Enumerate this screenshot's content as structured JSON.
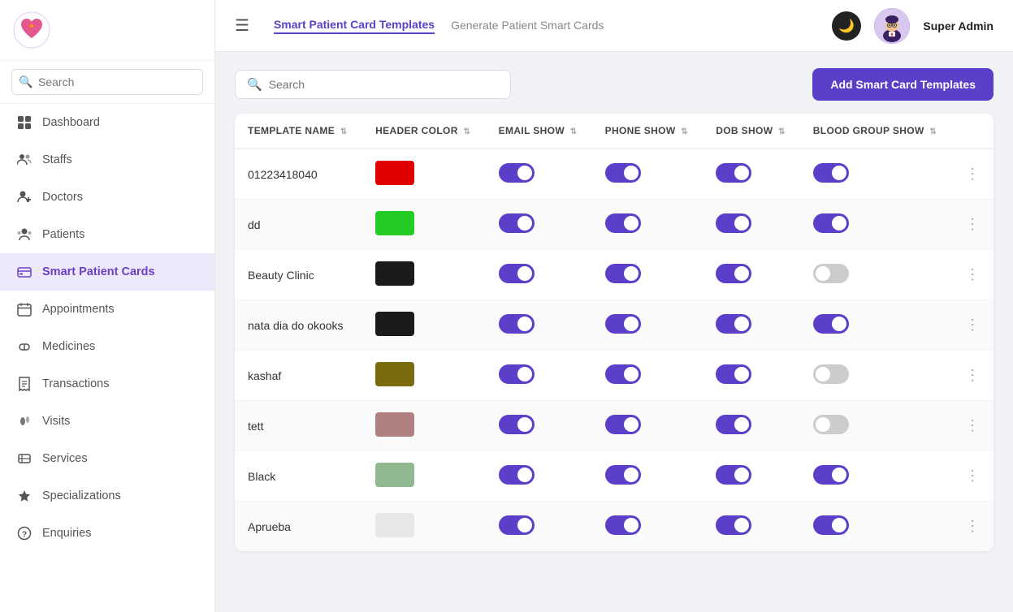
{
  "sidebar": {
    "logo_alt": "App Logo",
    "search_placeholder": "Search",
    "nav_items": [
      {
        "id": "dashboard",
        "label": "Dashboard",
        "icon": "grid",
        "active": false
      },
      {
        "id": "staffs",
        "label": "Staffs",
        "icon": "people",
        "active": false
      },
      {
        "id": "doctors",
        "label": "Doctors",
        "icon": "person-add",
        "active": false
      },
      {
        "id": "patients",
        "label": "Patients",
        "icon": "people-group",
        "active": false
      },
      {
        "id": "smart-patient-cards",
        "label": "Smart Patient Cards",
        "icon": "card",
        "active": true
      },
      {
        "id": "appointments",
        "label": "Appointments",
        "icon": "calendar",
        "active": false
      },
      {
        "id": "medicines",
        "label": "Medicines",
        "icon": "pill",
        "active": false
      },
      {
        "id": "transactions",
        "label": "Transactions",
        "icon": "receipt",
        "active": false
      },
      {
        "id": "visits",
        "label": "Visits",
        "icon": "footprint",
        "active": false
      },
      {
        "id": "services",
        "label": "Services",
        "icon": "service",
        "active": false
      },
      {
        "id": "specializations",
        "label": "Specializations",
        "icon": "star",
        "active": false
      },
      {
        "id": "enquiries",
        "label": "Enquiries",
        "icon": "question",
        "active": false
      }
    ]
  },
  "header": {
    "title": "Smart Patient Card Templates",
    "sub_link": "Generate Patient Smart Cards",
    "user_name": "Super Admin",
    "dark_mode_icon": "🌙"
  },
  "toolbar": {
    "search_placeholder": "Search",
    "add_button_label": "Add Smart Card Templates"
  },
  "table": {
    "columns": [
      {
        "id": "template_name",
        "label": "TEMPLATE NAME"
      },
      {
        "id": "header_color",
        "label": "HEADER COLOR"
      },
      {
        "id": "email_show",
        "label": "EMAIL SHOW"
      },
      {
        "id": "phone_show",
        "label": "PHONE SHOW"
      },
      {
        "id": "dob_show",
        "label": "DOB SHOW"
      },
      {
        "id": "blood_group_show",
        "label": "BLOOD GROUP SHOW"
      }
    ],
    "rows": [
      {
        "template_name": "01223418040",
        "header_color": "#e00000",
        "email_show": true,
        "phone_show": true,
        "dob_show": true,
        "blood_group_show": true
      },
      {
        "template_name": "dd",
        "header_color": "#22cc22",
        "email_show": true,
        "phone_show": true,
        "dob_show": true,
        "blood_group_show": true
      },
      {
        "template_name": "Beauty Clinic",
        "header_color": "#1a1a1a",
        "email_show": true,
        "phone_show": true,
        "dob_show": true,
        "blood_group_show": false
      },
      {
        "template_name": "nata dia do okooks",
        "header_color": "#1a1a1a",
        "email_show": true,
        "phone_show": true,
        "dob_show": true,
        "blood_group_show": true
      },
      {
        "template_name": "kashaf",
        "header_color": "#7a6a10",
        "email_show": true,
        "phone_show": true,
        "dob_show": true,
        "blood_group_show": false
      },
      {
        "template_name": "tett",
        "header_color": "#b08080",
        "email_show": true,
        "phone_show": true,
        "dob_show": true,
        "blood_group_show": false
      },
      {
        "template_name": "Black",
        "header_color": "#90b890",
        "email_show": true,
        "phone_show": true,
        "dob_show": true,
        "blood_group_show": true
      },
      {
        "template_name": "Aprueba",
        "header_color": "#e8e8e8",
        "email_show": true,
        "phone_show": true,
        "dob_show": true,
        "blood_group_show": true
      }
    ]
  }
}
